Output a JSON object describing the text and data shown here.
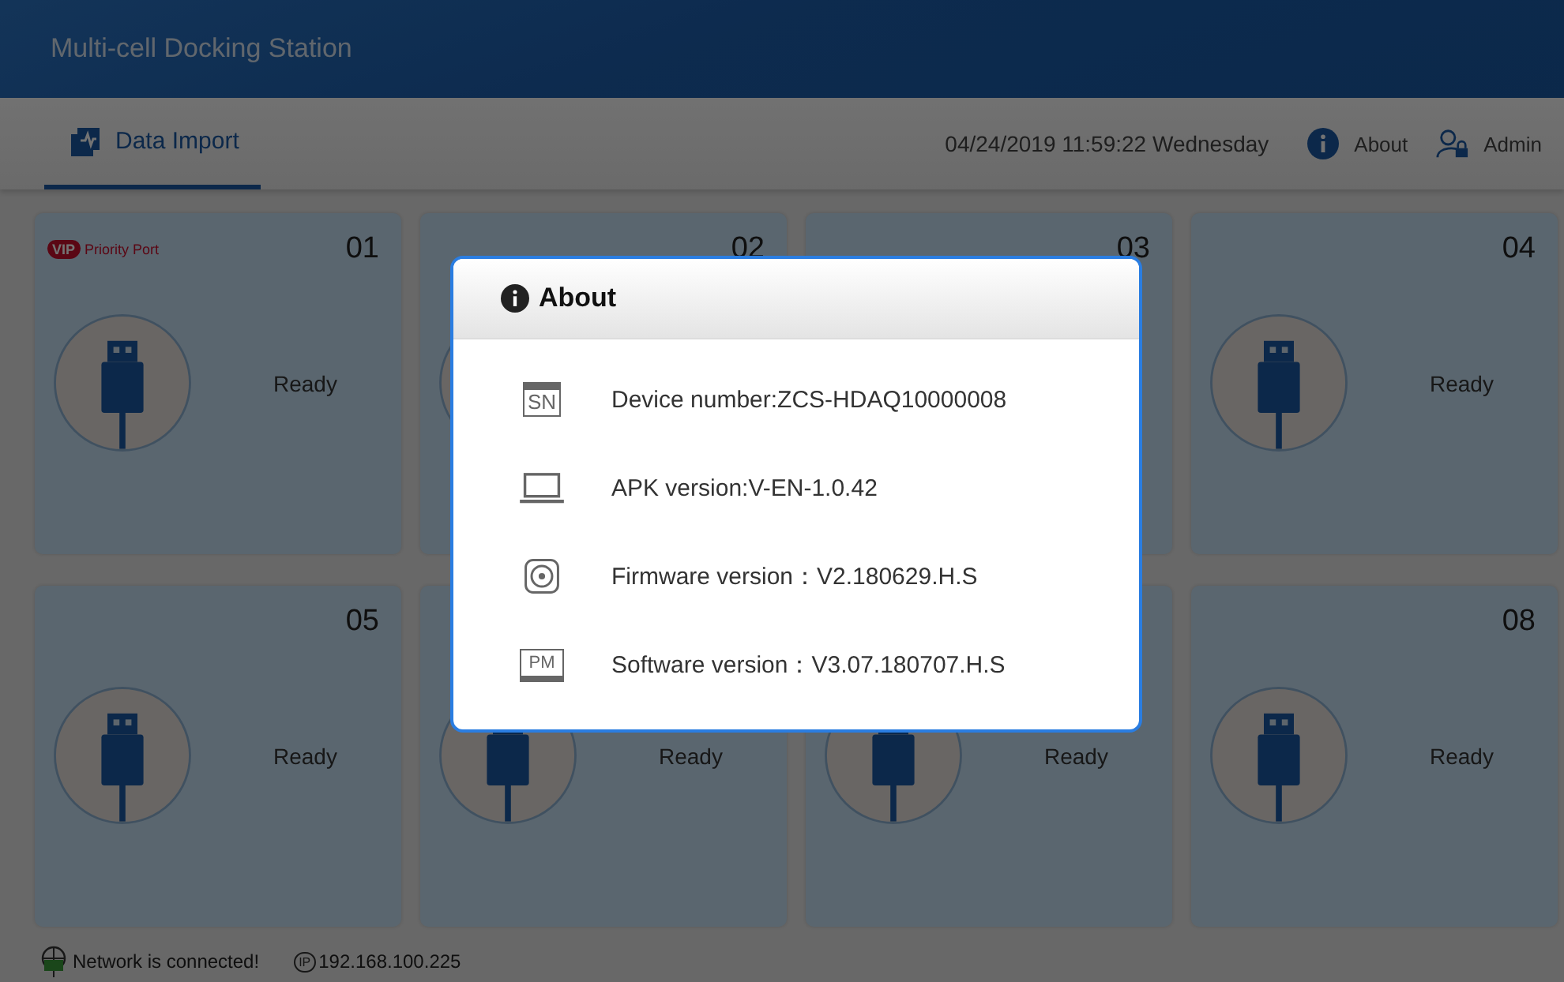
{
  "window": {
    "title": "Multi-cell Docking Station"
  },
  "tabs": [
    {
      "label": "Data Import",
      "selected": true
    }
  ],
  "header_right": {
    "datetime": "04/24/2019 11:59:22 Wednesday",
    "about": "About",
    "admin": "Admin"
  },
  "ports": [
    {
      "number": "01",
      "status": "Ready",
      "vip": "VIP",
      "priority_label": "Priority Port"
    },
    {
      "number": "02"
    },
    {
      "number": "03"
    },
    {
      "number": "04",
      "status": "Ready"
    },
    {
      "number": "05",
      "status": "Ready"
    },
    {
      "status": "Ready"
    },
    {
      "status": "Ready"
    },
    {
      "number": "08",
      "status": "Ready"
    }
  ],
  "dialog": {
    "title": "About",
    "rows": [
      {
        "kind": "sn",
        "icon_text": "SN",
        "text": "Device number:ZCS-HDAQ10000008"
      },
      {
        "kind": "laptop",
        "text": "APK version:V-EN-1.0.42"
      },
      {
        "kind": "disk",
        "text": "Firmware version：V2.180629.H.S"
      },
      {
        "kind": "pm",
        "icon_text": "PM",
        "text": "Software version：V3.07.180707.H.S"
      }
    ]
  },
  "status_bar": {
    "network": "Network is connected!",
    "ip_icon_text": "IP",
    "ip": "192.168.100.225"
  }
}
